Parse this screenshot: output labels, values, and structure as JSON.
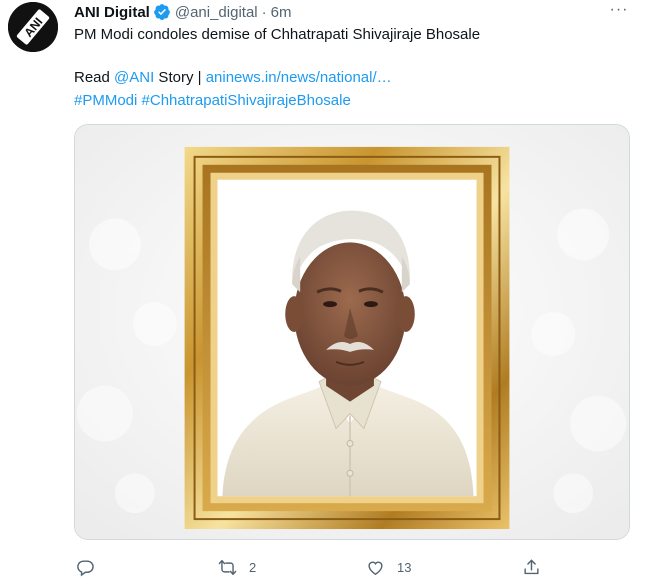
{
  "tweet": {
    "display_name": "ANI Digital",
    "handle": "@ani_digital",
    "separator": "·",
    "time": "6m",
    "more_label": "···",
    "avatar_text": "ANI",
    "line1": "PM Modi condoles demise of Chhatrapati Shivajiraje Bhosale",
    "line2_prefix": "Read ",
    "mention": "@ANI",
    "line2_mid": " Story | ",
    "link_text": "aninews.in/news/national/…",
    "hashtag1": "#PMModi",
    "hashtag2": "#ChhatrapatiShivajirajeBhosale"
  },
  "actions": {
    "reply_count": "",
    "retweet_count": "2",
    "like_count": "13"
  },
  "colors": {
    "link": "#1d9bf0",
    "muted": "#536471",
    "frame_gold": "#c99a3a"
  },
  "icons": [
    "verified-badge-icon",
    "more-icon",
    "reply-icon",
    "retweet-icon",
    "like-icon",
    "share-icon"
  ]
}
